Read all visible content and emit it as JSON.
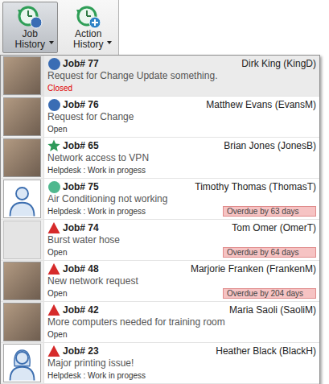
{
  "toolbar": {
    "buttons": [
      {
        "label": "Job History",
        "selected": true,
        "kind": "job"
      },
      {
        "label": "Action History",
        "selected": false,
        "kind": "action"
      }
    ]
  },
  "jobs": [
    {
      "number": "Job# 77",
      "name": "Dirk King (KingD)",
      "summary": "Request for Change Update something.",
      "status": "Closed",
      "status_color": "#e00000",
      "priority": {
        "kind": "circle",
        "color": "#3a6db4"
      },
      "avatar": "photo",
      "selected": true
    },
    {
      "number": "Job# 76",
      "name": "Matthew Evans (EvansM)",
      "summary": "Request for Change",
      "status": "Open",
      "status_color": "#333333",
      "priority": {
        "kind": "circle",
        "color": "#3a6db4"
      },
      "avatar": "photo",
      "selected": false
    },
    {
      "number": "Job# 65",
      "name": "Brian Jones (JonesB)",
      "summary": "Network access to VPN",
      "status": "Helpdesk : Work in progess",
      "status_color": "#333333",
      "priority": {
        "kind": "star",
        "color": "#2f9a5a"
      },
      "avatar": "photo",
      "selected": false
    },
    {
      "number": "Job# 75",
      "name": "Timothy Thomas (ThomasT)",
      "summary": "Air Conditioning not working",
      "status": "Helpdesk : Work in progess",
      "status_color": "#333333",
      "priority": {
        "kind": "circle",
        "color": "#4fb88e"
      },
      "avatar": "male",
      "selected": false,
      "overdue": "Overdue by 63 days"
    },
    {
      "number": "Job# 74",
      "name": "Tom Omer (OmerT)",
      "summary": "Burst water hose",
      "status": "Open",
      "status_color": "#333333",
      "priority": {
        "kind": "triangle",
        "color": "#d62b2b"
      },
      "avatar": "none",
      "selected": false,
      "overdue": "Overdue by 64 days"
    },
    {
      "number": "Job# 48",
      "name": "Marjorie Franken (FrankenM)",
      "summary": "New network request",
      "status": "Open",
      "status_color": "#333333",
      "priority": {
        "kind": "triangle",
        "color": "#d62b2b"
      },
      "avatar": "photo",
      "selected": false,
      "overdue": "Overdue by 204 days"
    },
    {
      "number": "Job# 42",
      "name": "Maria Saoli (SaoliM)",
      "summary": "More computers needed for training room",
      "status": "Open",
      "status_color": "#333333",
      "priority": {
        "kind": "triangle",
        "color": "#d62b2b"
      },
      "avatar": "photo",
      "selected": false
    },
    {
      "number": "Job# 23",
      "name": "Heather Black (BlackH)",
      "summary": "Major printing issue!",
      "status": "Helpdesk : Work in progess",
      "status_color": "#333333",
      "priority": {
        "kind": "triangle",
        "color": "#d62b2b"
      },
      "avatar": "female",
      "selected": false
    }
  ]
}
